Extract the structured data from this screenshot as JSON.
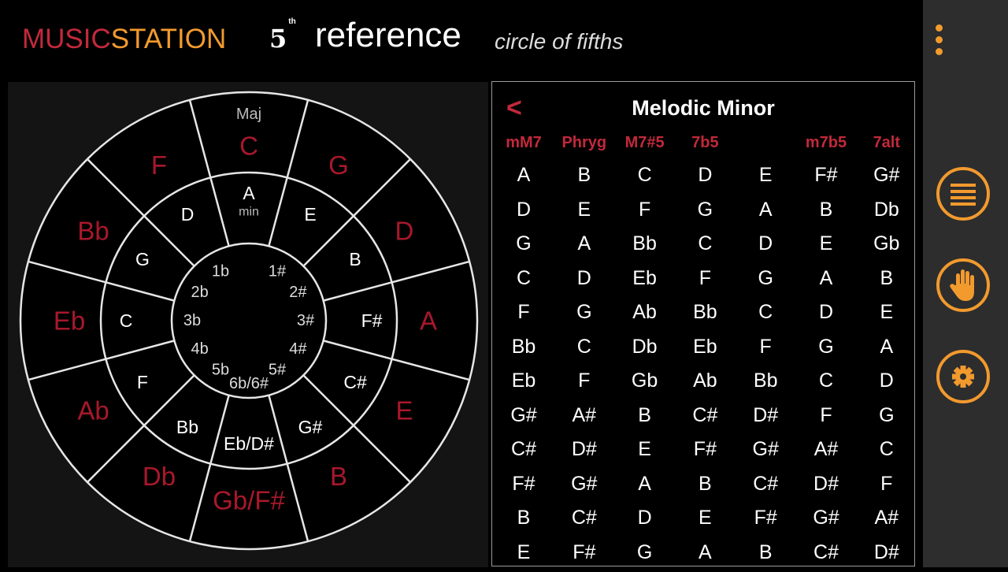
{
  "header": {
    "brand_part1": "MUSIC",
    "brand_part2": "STATION",
    "badge_number": "5",
    "badge_suffix": "th",
    "title": "reference",
    "subtitle": "circle of fifths"
  },
  "wheel": {
    "major_label": "Maj",
    "minor_label": "min",
    "outer_keys": [
      "C",
      "G",
      "D",
      "A",
      "E",
      "B",
      "Gb/F#",
      "Db",
      "Ab",
      "Eb",
      "Bb",
      "F"
    ],
    "minor_keys": [
      "A",
      "E",
      "B",
      "F#",
      "C#",
      "G#",
      "Eb/D#",
      "Bb",
      "F",
      "C",
      "G",
      "D"
    ],
    "signatures": [
      "",
      "1#",
      "2#",
      "3#",
      "4#",
      "5#",
      "6b/6#",
      "5b",
      "4b",
      "3b",
      "2b",
      "1b"
    ]
  },
  "scale_table": {
    "back_label": "<",
    "title": "Melodic Minor",
    "mode_headers": [
      "mM7",
      "Phryg",
      "M7#5",
      "7b5",
      "",
      "m7b5",
      "7alt"
    ],
    "rows": [
      [
        "A",
        "B",
        "C",
        "D",
        "E",
        "F#",
        "G#"
      ],
      [
        "D",
        "E",
        "F",
        "G",
        "A",
        "B",
        "Db"
      ],
      [
        "G",
        "A",
        "Bb",
        "C",
        "D",
        "E",
        "Gb"
      ],
      [
        "C",
        "D",
        "Eb",
        "F",
        "G",
        "A",
        "B"
      ],
      [
        "F",
        "G",
        "Ab",
        "Bb",
        "C",
        "D",
        "E"
      ],
      [
        "Bb",
        "C",
        "Db",
        "Eb",
        "F",
        "G",
        "A"
      ],
      [
        "Eb",
        "F",
        "Gb",
        "Ab",
        "Bb",
        "C",
        "D"
      ],
      [
        "G#",
        "A#",
        "B",
        "C#",
        "D#",
        "F",
        "G"
      ],
      [
        "C#",
        "D#",
        "E",
        "F#",
        "G#",
        "A#",
        "C"
      ],
      [
        "F#",
        "G#",
        "A",
        "B",
        "C#",
        "D#",
        "F"
      ],
      [
        "B",
        "C#",
        "D",
        "E",
        "F#",
        "G#",
        "A#"
      ],
      [
        "E",
        "F#",
        "G",
        "A",
        "B",
        "C#",
        "D#"
      ]
    ]
  },
  "sidebar": {
    "icons": [
      "more-icon",
      "list-icon",
      "hand-icon",
      "gear-icon"
    ]
  },
  "colors": {
    "accent_orange": "#f29a2e",
    "accent_red": "#c2293b",
    "major_key_color": "#a8182b"
  }
}
